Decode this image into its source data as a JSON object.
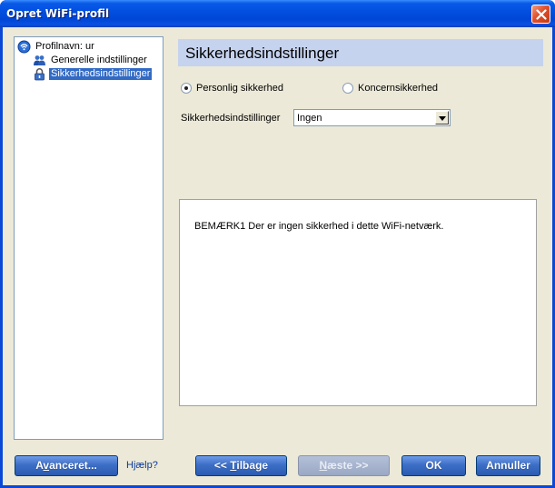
{
  "window": {
    "title": "Opret WiFi-profil"
  },
  "tree": {
    "root_label": "Profilnavn: ur",
    "items": [
      {
        "label": "Generelle indstillinger",
        "icon": "users-icon",
        "selected": false
      },
      {
        "label": "Sikkerhedsindstillinger",
        "icon": "lock-icon",
        "selected": true
      }
    ]
  },
  "header": {
    "title": "Sikkerhedsindstillinger"
  },
  "security_mode": {
    "personal_label": "Personlig sikkerhed",
    "enterprise_label": "Koncernsikkerhed",
    "selected": "personal"
  },
  "security_settings": {
    "label": "Sikkerhedsindstillinger",
    "value": "Ingen"
  },
  "note": {
    "text": "BEMÆRK1 Der er ingen sikkerhed i dette WiFi-netværk."
  },
  "buttons": {
    "advanced": {
      "pre": "A",
      "ul": "v",
      "post": "anceret..."
    },
    "help": "Hjælp?",
    "back": {
      "pre": "<< ",
      "ul": "T",
      "post": "ilbage"
    },
    "next": {
      "pre": "",
      "ul": "N",
      "post": "æste >>"
    },
    "ok": "OK",
    "cancel": "Annuller"
  },
  "colors": {
    "titlebar": "#0350e0",
    "header_band": "#c6d3ef",
    "selection": "#316ac5",
    "dialog_bg": "#ece9d8"
  }
}
